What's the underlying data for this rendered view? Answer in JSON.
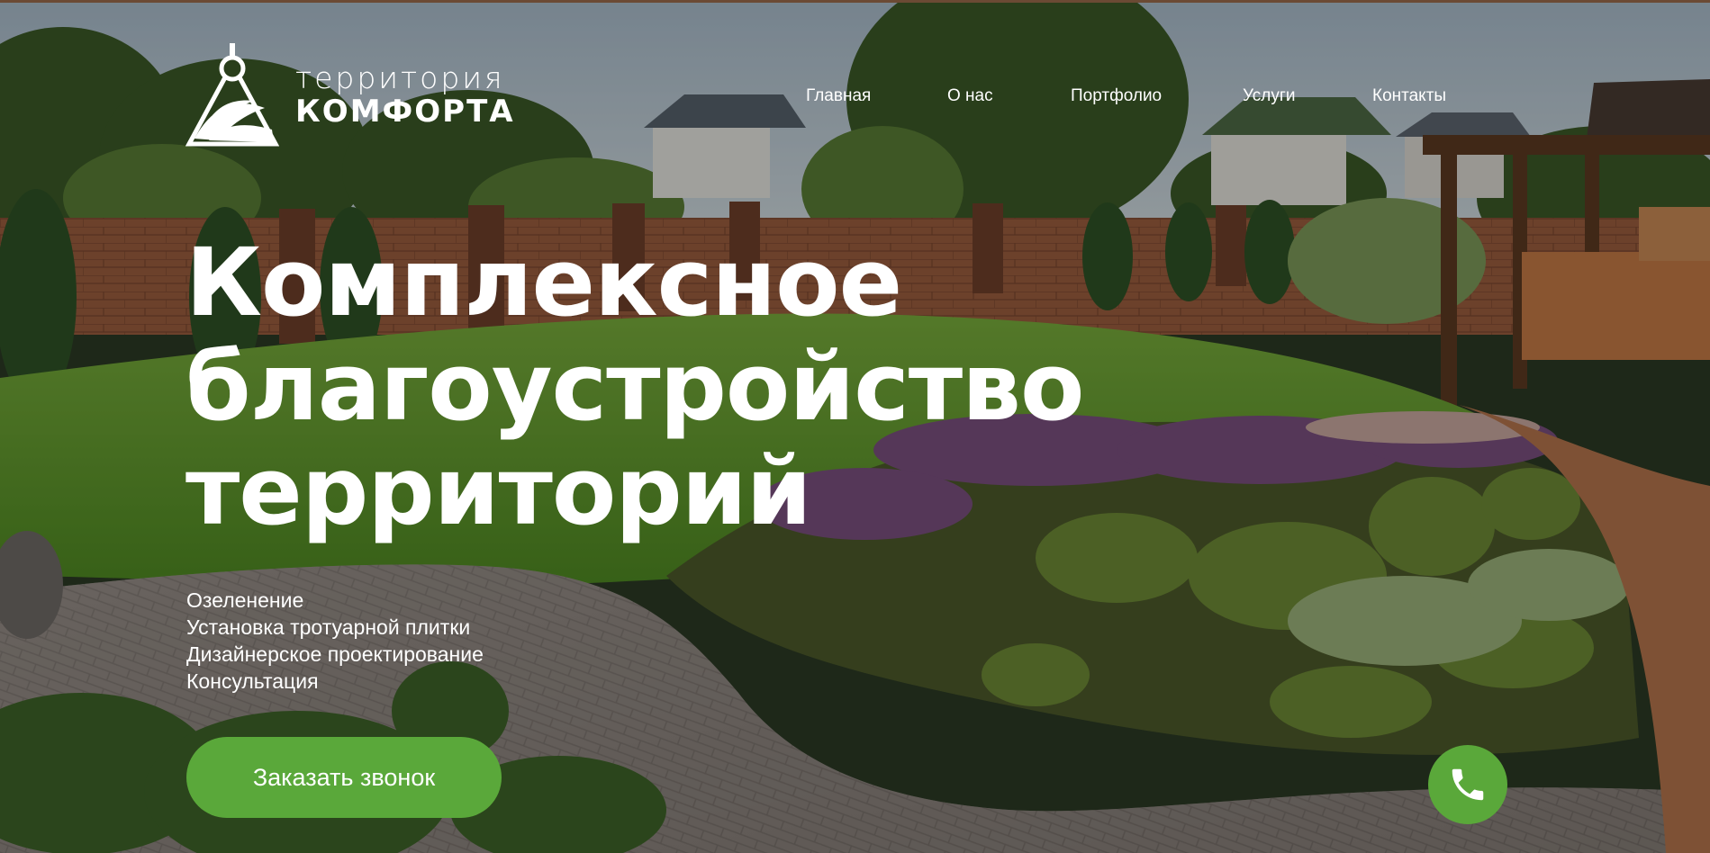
{
  "brand": {
    "line1": "территория",
    "line2": "КОМФОРТА"
  },
  "nav": [
    {
      "label": "Главная"
    },
    {
      "label": "О нас"
    },
    {
      "label": "Портфолио"
    },
    {
      "label": "Услуги"
    },
    {
      "label": "Контакты"
    }
  ],
  "hero": {
    "title_lines": [
      "Комплексное",
      "благоустройство",
      "территорий"
    ],
    "services": [
      "Озеленение",
      "Установка тротуарной плитки",
      "Дизайнерское проектирование",
      "Консультация"
    ],
    "cta_label": "Заказать звонок"
  },
  "icons": {
    "logo": "compass-leaf-logo-icon",
    "phone": "phone-icon"
  },
  "colors": {
    "accent": "#5aa83a",
    "text": "#ffffff",
    "overlay": "rgba(0,0,0,0.30)"
  }
}
